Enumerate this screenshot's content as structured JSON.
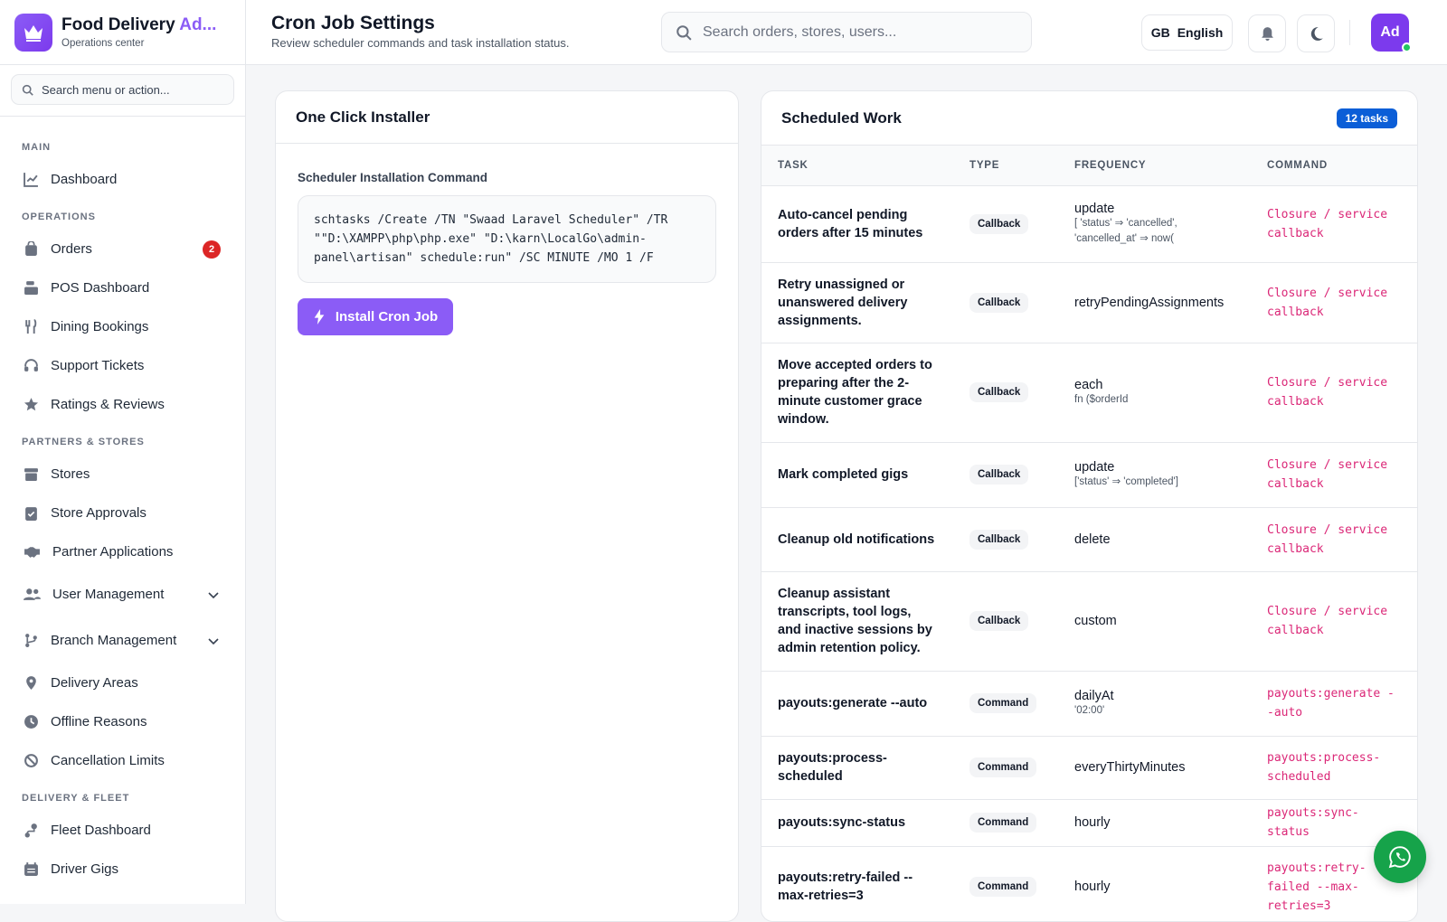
{
  "app": {
    "title_main": "Food Delivery ",
    "title_accent": "Ad...",
    "subtitle": "Operations center"
  },
  "sidebar": {
    "search_placeholder": "Search menu or action...",
    "sections": {
      "main": "MAIN",
      "operations": "OPERATIONS",
      "partners": "PARTNERS & STORES",
      "fleet": "DELIVERY & FLEET"
    },
    "items": {
      "dashboard": "Dashboard",
      "orders": "Orders",
      "orders_badge": "2",
      "pos": "POS Dashboard",
      "dining": "Dining Bookings",
      "support": "Support Tickets",
      "ratings": "Ratings & Reviews",
      "stores": "Stores",
      "store_approvals": "Store Approvals",
      "partner_apps": "Partner Applications",
      "user_mgmt": "User Management",
      "branch_mgmt": "Branch Management",
      "delivery_areas": "Delivery Areas",
      "offline_reasons": "Offline Reasons",
      "cancel_limits": "Cancellation Limits",
      "fleet_dashboard": "Fleet Dashboard",
      "driver_gigs": "Driver Gigs"
    }
  },
  "header": {
    "title": "Cron Job Settings",
    "subtitle": "Review scheduler commands and task installation status.",
    "search_placeholder": "Search orders, stores, users...",
    "lang_code": "GB",
    "lang_name": "English",
    "avatar": "Ad"
  },
  "installer": {
    "title": "One Click Installer",
    "label": "Scheduler Installation Command",
    "command": "schtasks /Create /TN \"Swaad Laravel Scheduler\" /TR\n\"\"D:\\XAMPP\\php\\php.exe\" \"D:\\karn\\LocalGo\\admin-\npanel\\artisan\" schedule:run\" /SC MINUTE /MO 1 /F",
    "button": "Install Cron Job"
  },
  "scheduled": {
    "title": "Scheduled Work",
    "count": "12 tasks",
    "columns": {
      "task": "TASK",
      "type": "TYPE",
      "frequency": "FREQUENCY",
      "command": "COMMAND"
    },
    "rows": [
      {
        "task": "Auto-cancel pending orders after 15 minutes",
        "type": "Callback",
        "freq": "update",
        "freq_sub": "[ 'status' ⇒ 'cancelled', 'cancelled_at' ⇒ now(",
        "command": "Closure / service callback"
      },
      {
        "task": "Retry unassigned or unanswered delivery assignments.",
        "type": "Callback",
        "freq": "retryPendingAssignments",
        "freq_sub": "",
        "command": "Closure / service callback"
      },
      {
        "task": "Move accepted orders to preparing after the 2-minute customer grace window.",
        "type": "Callback",
        "freq": "each",
        "freq_sub": "fn ($orderId",
        "command": "Closure / service callback"
      },
      {
        "task": "Mark completed gigs",
        "type": "Callback",
        "freq": "update",
        "freq_sub": "['status' ⇒ 'completed']",
        "command": "Closure / service callback"
      },
      {
        "task": "Cleanup old notifications",
        "type": "Callback",
        "freq": "delete",
        "freq_sub": "",
        "command": "Closure / service callback"
      },
      {
        "task": "Cleanup assistant transcripts, tool logs, and inactive sessions by admin retention policy.",
        "type": "Callback",
        "freq": "custom",
        "freq_sub": "",
        "command": "Closure / service callback"
      },
      {
        "task": "payouts:generate --auto",
        "type": "Command",
        "freq": "dailyAt",
        "freq_sub": "'02:00'",
        "command": "payouts:generate --auto"
      },
      {
        "task": "payouts:process-scheduled",
        "type": "Command",
        "freq": "everyThirtyMinutes",
        "freq_sub": "",
        "command": "payouts:process-scheduled"
      },
      {
        "task": "payouts:sync-status",
        "type": "Command",
        "freq": "hourly",
        "freq_sub": "",
        "command": "payouts:sync-status"
      },
      {
        "task": "payouts:retry-failed --max-retries=3",
        "type": "Command",
        "freq": "hourly",
        "freq_sub": "",
        "command": "payouts:retry-failed --max-retries=3"
      }
    ]
  }
}
